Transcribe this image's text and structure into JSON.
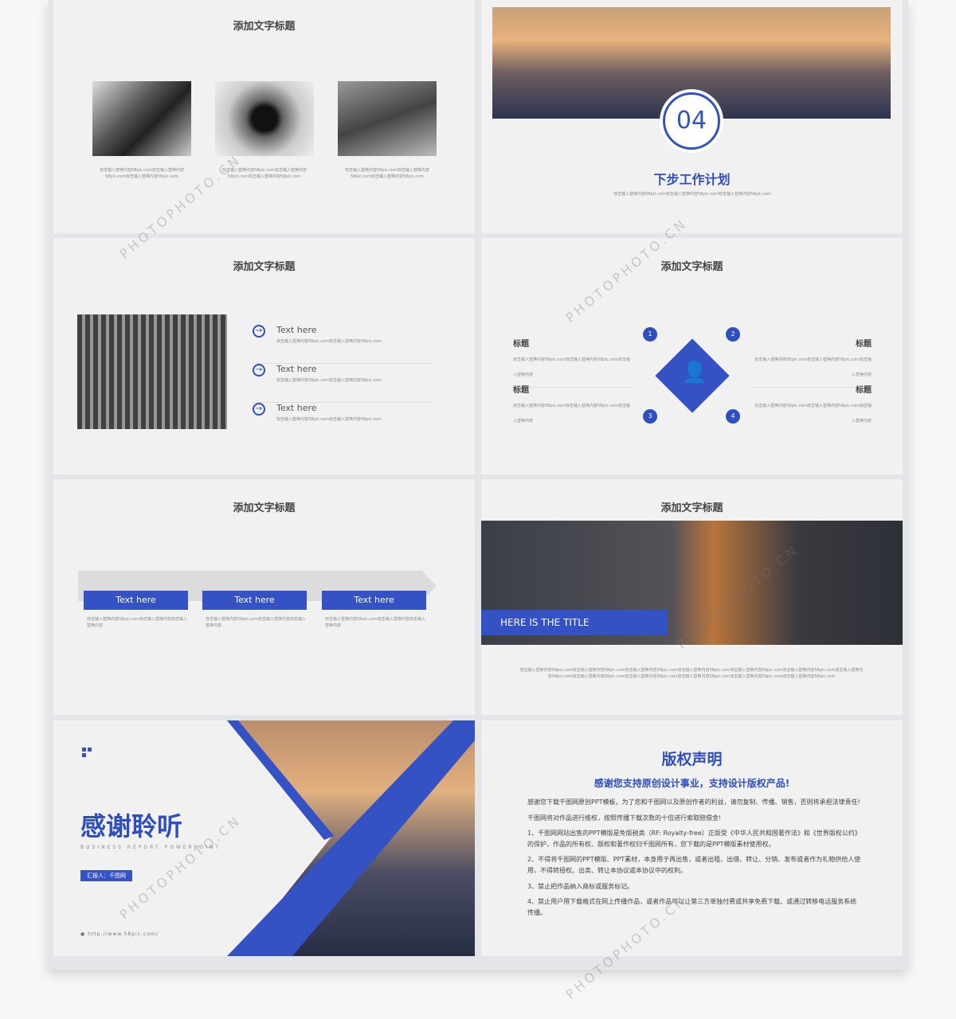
{
  "slides": {
    "s1": {
      "title": "添加文字标题",
      "captions": [
        "双击输入替换内容58pic.com双击输入替换内容58pic.com双击输入替换内容58pic.com",
        "双击输入替换内容58pic.com双击输入替换内容58pic.com双击输入替换内容58pic.com",
        "双击输入替换内容58pic.com双击输入替换内容58pic.com双击输入替换内容58pic.com"
      ]
    },
    "s2": {
      "number": "04",
      "title": "下步工作计划",
      "desc": "双击输入替换内容58pic.com双击输入替换内容58pic.com双击输入替换内容58pic.com"
    },
    "s3": {
      "title": "添加文字标题",
      "items": [
        {
          "label": "Text here",
          "desc": "双击输入替换内容58pic.com双击输入替换内容58pic.com"
        },
        {
          "label": "Text here",
          "desc": "双击输入替换内容58pic.com双击输入替换内容58pic.com"
        },
        {
          "label": "Text here",
          "desc": "双击输入替换内容58pic.com双击输入替换内容58pic.com"
        }
      ]
    },
    "s4": {
      "title": "添加文字标题",
      "numbers": [
        "1",
        "2",
        "3",
        "4"
      ],
      "items": [
        {
          "label": "标题",
          "desc": "双击输入替换内容58pic.com双击输入替换内容58pic.com双击输入替换内容"
        },
        {
          "label": "标题",
          "desc": "双击输入替换内容58pic.com双击输入替换内容58pic.com双击输入替换内容"
        },
        {
          "label": "标题",
          "desc": "双击输入替换内容58pic.com双击输入替换内容58pic.com双击输入替换内容"
        },
        {
          "label": "标题",
          "desc": "双击输入替换内容58pic.com双击输入替换内容58pic.com双击输入替换内容"
        }
      ]
    },
    "s5": {
      "title": "添加文字标题",
      "buttons": [
        "Text here",
        "Text here",
        "Text here"
      ],
      "captions": [
        "双击输入替换内容58pic.com双击输入替换内容双击输入替换内容",
        "双击输入替换内容58pic.com双击输入替换内容双击输入替换内容",
        "双击输入替换内容58pic.com双击输入替换内容双击输入替换内容"
      ]
    },
    "s6": {
      "title": "添加文字标题",
      "banner": "HERE IS THE TITLE",
      "desc": "双击输入替换内容58pic.com双击输入替换内容58pic.com双击输入替换内容58pic.com双击输入替换内容58pic.com双击输入替换内容58pic.com双击输入替换内容58pic.com双击输入替换内容58pic.com双击输入替换内容58pic.com双击输入替换内容58pic.com双击输入替换内容58pic.com双击输入替换内容58pic.com双击输入替换内容58pic.com"
    },
    "s7": {
      "title": "感谢聆听",
      "subtitle": "BUSINESS REPORT POWERPOINT",
      "reporter": "汇报人：千图网",
      "url": "http://www.58pic.com/"
    },
    "s8": {
      "title": "版权声明",
      "subtitle": "感谢您支持原创设计事业，支持设计版权产品!",
      "paragraphs": [
        "感谢您下载千图网原创PPT模板，为了您和千图网以及原创作者的利益，请勿复制、传播、销售，否则将承担法律责任!",
        "千图网将对作品进行维权，按照传播下载次数的十倍进行索取赔偿金!",
        "1、千图网网站出售的PPT模版是免版税类（RF: Royalty-free）正版受《中华人民共和国著作法》和《世界版权公约》的保护，作品的所有权、版权和著作权归千图网所有，您下载的是PPT模版素材使用权。",
        "2、不得将千图网的PPT模版、PPT素材，本身用于再出售，或者出租、出借、转让、分销、发布或者作为礼物供他人使用，不得转授权、出卖、转让本协议或本协议中的权利。",
        "3、禁止把作品纳入商标或服务标记。",
        "4、禁止用户用下载格式在网上传播作品，或者作品可以让第三方单独付费或共享免费下载、或通过转移电话服务系统传播。"
      ]
    }
  },
  "watermark": "PHOTOPHOTO.CN",
  "colors": {
    "accent": "#3452c4",
    "slide_bg": "#f1f1f2"
  }
}
